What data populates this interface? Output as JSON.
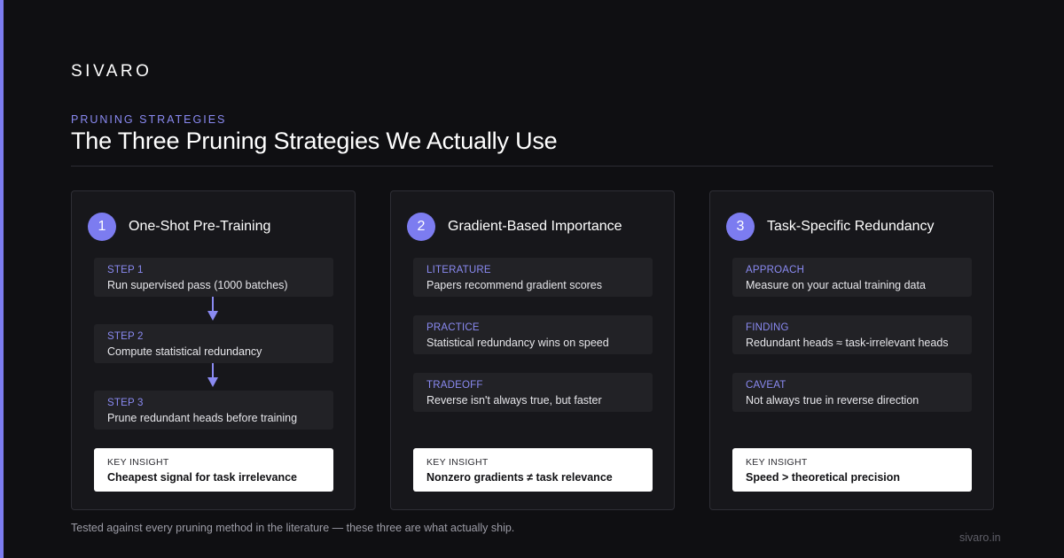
{
  "brand": "SIVARO",
  "eyebrow": "PRUNING STRATEGIES",
  "title": "The Three Pruning Strategies We Actually Use",
  "accent_color": "#7c7cf0",
  "cards": [
    {
      "number": "1",
      "title": "One-Shot Pre-Training",
      "items": [
        {
          "label": "STEP 1",
          "text": "Run supervised pass (1000 batches)"
        },
        {
          "label": "STEP 2",
          "text": "Compute statistical redundancy"
        },
        {
          "label": "STEP 3",
          "text": "Prune redundant heads before training"
        }
      ],
      "insight_label": "KEY INSIGHT",
      "insight_text": "Cheapest signal for task irrelevance"
    },
    {
      "number": "2",
      "title": "Gradient-Based Importance",
      "items": [
        {
          "label": "LITERATURE",
          "text": "Papers recommend gradient scores"
        },
        {
          "label": "PRACTICE",
          "text": "Statistical redundancy wins on speed"
        },
        {
          "label": "TRADEOFF",
          "text": "Reverse isn't always true, but faster"
        }
      ],
      "insight_label": "KEY INSIGHT",
      "insight_text": "Nonzero gradients ≠ task relevance"
    },
    {
      "number": "3",
      "title": "Task-Specific Redundancy",
      "items": [
        {
          "label": "APPROACH",
          "text": "Measure on your actual training data"
        },
        {
          "label": "FINDING",
          "text": "Redundant heads ≈ task-irrelevant heads"
        },
        {
          "label": "CAVEAT",
          "text": "Not always true in reverse direction"
        }
      ],
      "insight_label": "KEY INSIGHT",
      "insight_text": "Speed > theoretical precision"
    }
  ],
  "footer_note": "Tested against every pruning method in the literature — these three are what actually ship.",
  "footer_url": "sivaro.in"
}
